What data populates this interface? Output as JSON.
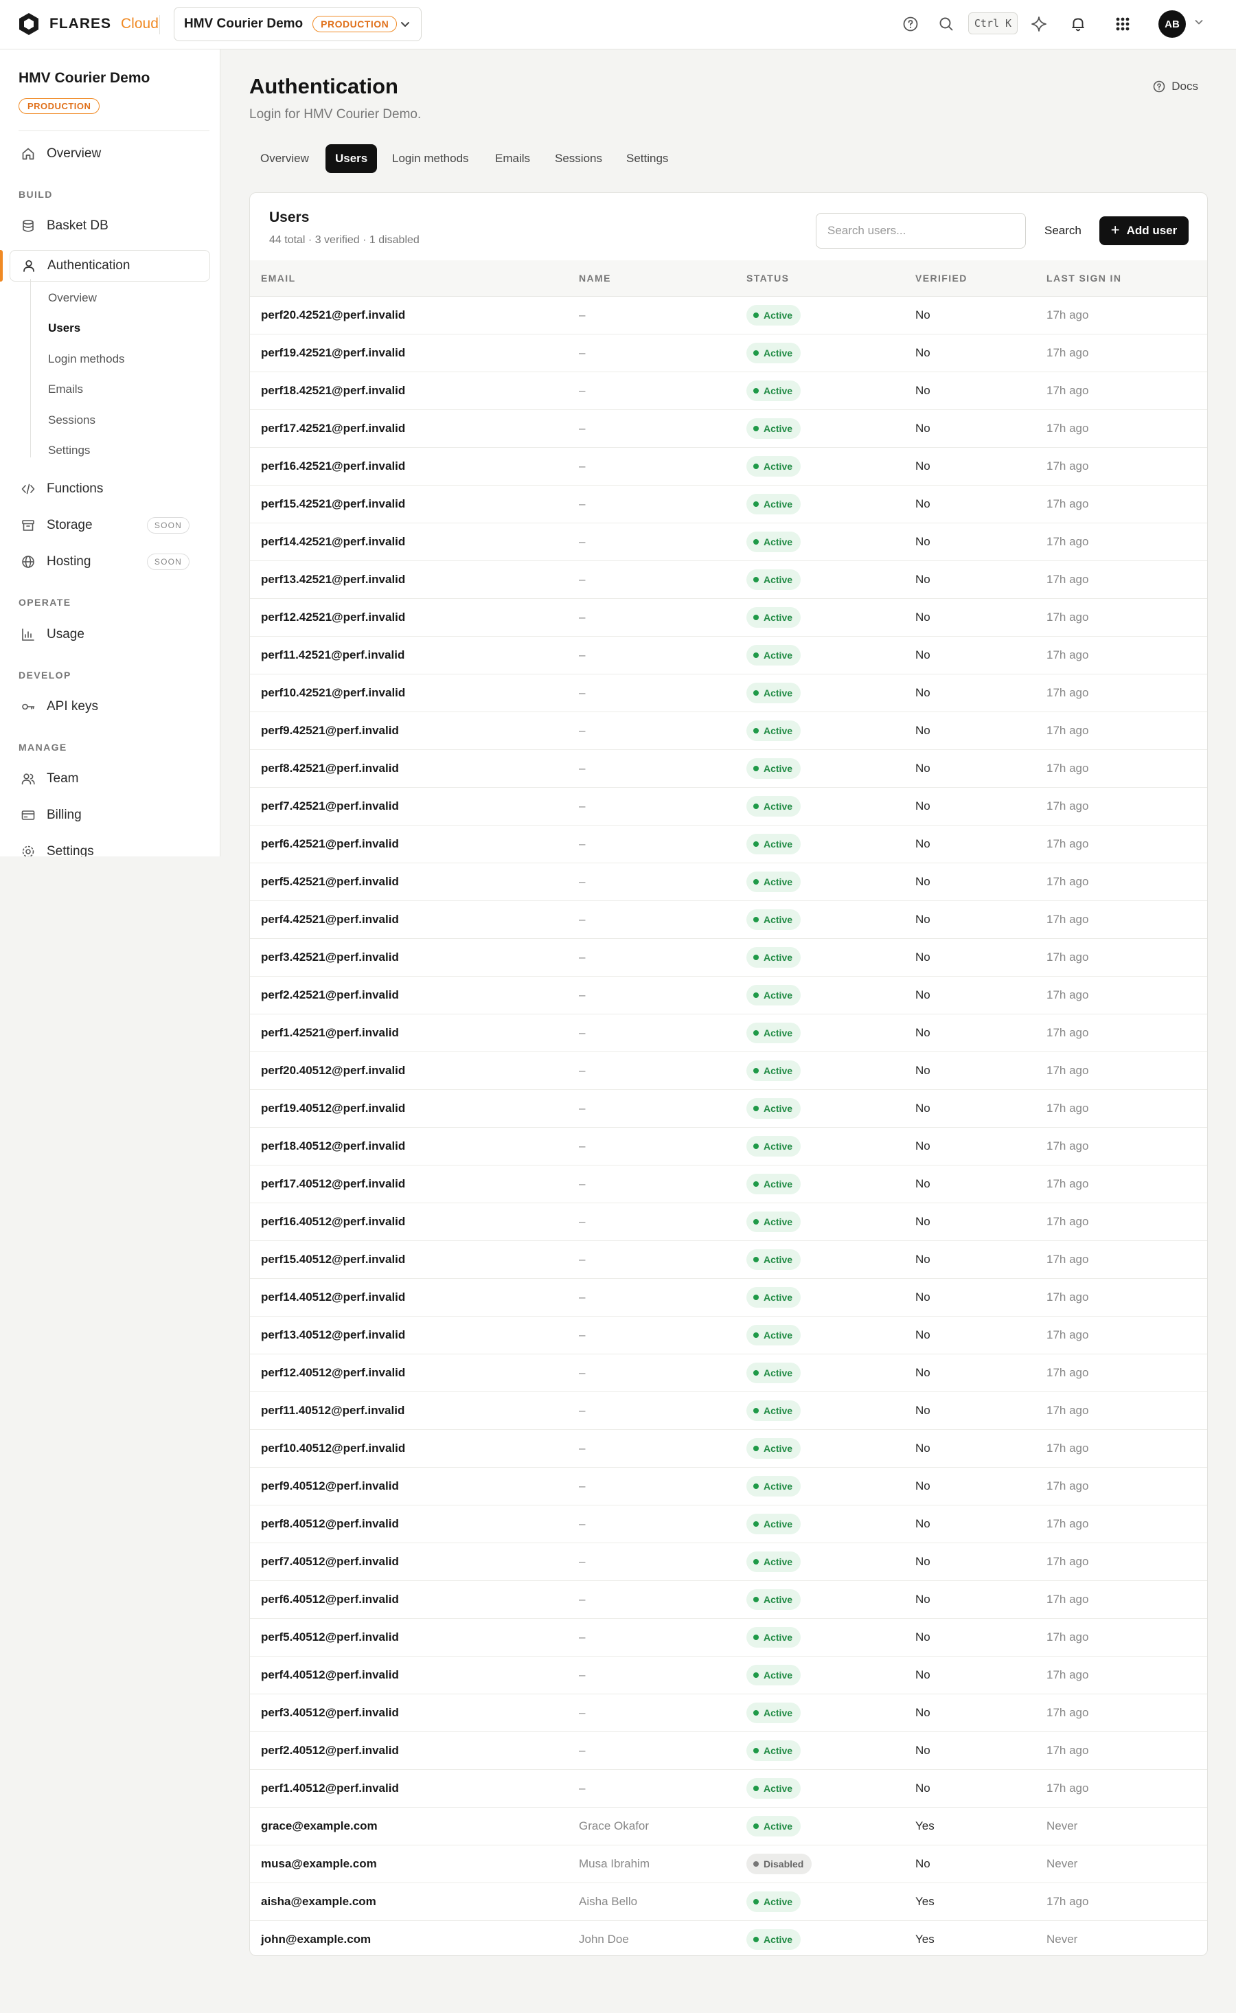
{
  "topbar": {
    "brand": "FLARES",
    "brand_sub": "Cloud",
    "project_name": "HMV Courier Demo",
    "env": "PRODUCTION",
    "shortcut": "Ctrl K",
    "avatar_initials": "AB"
  },
  "sidebar": {
    "project_name": "HMV Courier Demo",
    "env": "PRODUCTION",
    "overview": "Overview",
    "sections": {
      "build": "BUILD",
      "operate": "OPERATE",
      "develop": "DEVELOP",
      "manage": "MANAGE"
    },
    "basket_db": "Basket DB",
    "authentication": "Authentication",
    "auth_sub": [
      "Overview",
      "Users",
      "Login methods",
      "Emails",
      "Sessions",
      "Settings"
    ],
    "functions": "Functions",
    "storage": "Storage",
    "hosting": "Hosting",
    "soon": "SOON",
    "usage": "Usage",
    "api_keys": "API keys",
    "team": "Team",
    "billing": "Billing",
    "settings": "Settings"
  },
  "main": {
    "title": "Authentication",
    "subtitle": "Login for HMV Courier Demo.",
    "docs": "Docs",
    "tabs": [
      "Overview",
      "Users",
      "Login methods",
      "Emails",
      "Sessions",
      "Settings"
    ],
    "active_tab": "Users"
  },
  "users_card": {
    "title": "Users",
    "meta": "44 total · 3 verified · 1 disabled",
    "search_placeholder": "Search users...",
    "search_button": "Search",
    "add_button": "Add user",
    "columns": [
      "EMAIL",
      "NAME",
      "STATUS",
      "VERIFIED",
      "LAST SIGN IN"
    ],
    "rows": [
      {
        "email": "perf20.42521@perf.invalid",
        "name": "–",
        "status": "Active",
        "verified": "No",
        "last": "17h ago"
      },
      {
        "email": "perf19.42521@perf.invalid",
        "name": "–",
        "status": "Active",
        "verified": "No",
        "last": "17h ago"
      },
      {
        "email": "perf18.42521@perf.invalid",
        "name": "–",
        "status": "Active",
        "verified": "No",
        "last": "17h ago"
      },
      {
        "email": "perf17.42521@perf.invalid",
        "name": "–",
        "status": "Active",
        "verified": "No",
        "last": "17h ago"
      },
      {
        "email": "perf16.42521@perf.invalid",
        "name": "–",
        "status": "Active",
        "verified": "No",
        "last": "17h ago"
      },
      {
        "email": "perf15.42521@perf.invalid",
        "name": "–",
        "status": "Active",
        "verified": "No",
        "last": "17h ago"
      },
      {
        "email": "perf14.42521@perf.invalid",
        "name": "–",
        "status": "Active",
        "verified": "No",
        "last": "17h ago"
      },
      {
        "email": "perf13.42521@perf.invalid",
        "name": "–",
        "status": "Active",
        "verified": "No",
        "last": "17h ago"
      },
      {
        "email": "perf12.42521@perf.invalid",
        "name": "–",
        "status": "Active",
        "verified": "No",
        "last": "17h ago"
      },
      {
        "email": "perf11.42521@perf.invalid",
        "name": "–",
        "status": "Active",
        "verified": "No",
        "last": "17h ago"
      },
      {
        "email": "perf10.42521@perf.invalid",
        "name": "–",
        "status": "Active",
        "verified": "No",
        "last": "17h ago"
      },
      {
        "email": "perf9.42521@perf.invalid",
        "name": "–",
        "status": "Active",
        "verified": "No",
        "last": "17h ago"
      },
      {
        "email": "perf8.42521@perf.invalid",
        "name": "–",
        "status": "Active",
        "verified": "No",
        "last": "17h ago"
      },
      {
        "email": "perf7.42521@perf.invalid",
        "name": "–",
        "status": "Active",
        "verified": "No",
        "last": "17h ago"
      },
      {
        "email": "perf6.42521@perf.invalid",
        "name": "–",
        "status": "Active",
        "verified": "No",
        "last": "17h ago"
      },
      {
        "email": "perf5.42521@perf.invalid",
        "name": "–",
        "status": "Active",
        "verified": "No",
        "last": "17h ago"
      },
      {
        "email": "perf4.42521@perf.invalid",
        "name": "–",
        "status": "Active",
        "verified": "No",
        "last": "17h ago"
      },
      {
        "email": "perf3.42521@perf.invalid",
        "name": "–",
        "status": "Active",
        "verified": "No",
        "last": "17h ago"
      },
      {
        "email": "perf2.42521@perf.invalid",
        "name": "–",
        "status": "Active",
        "verified": "No",
        "last": "17h ago"
      },
      {
        "email": "perf1.42521@perf.invalid",
        "name": "–",
        "status": "Active",
        "verified": "No",
        "last": "17h ago"
      },
      {
        "email": "perf20.40512@perf.invalid",
        "name": "–",
        "status": "Active",
        "verified": "No",
        "last": "17h ago"
      },
      {
        "email": "perf19.40512@perf.invalid",
        "name": "–",
        "status": "Active",
        "verified": "No",
        "last": "17h ago"
      },
      {
        "email": "perf18.40512@perf.invalid",
        "name": "–",
        "status": "Active",
        "verified": "No",
        "last": "17h ago"
      },
      {
        "email": "perf17.40512@perf.invalid",
        "name": "–",
        "status": "Active",
        "verified": "No",
        "last": "17h ago"
      },
      {
        "email": "perf16.40512@perf.invalid",
        "name": "–",
        "status": "Active",
        "verified": "No",
        "last": "17h ago"
      },
      {
        "email": "perf15.40512@perf.invalid",
        "name": "–",
        "status": "Active",
        "verified": "No",
        "last": "17h ago"
      },
      {
        "email": "perf14.40512@perf.invalid",
        "name": "–",
        "status": "Active",
        "verified": "No",
        "last": "17h ago"
      },
      {
        "email": "perf13.40512@perf.invalid",
        "name": "–",
        "status": "Active",
        "verified": "No",
        "last": "17h ago"
      },
      {
        "email": "perf12.40512@perf.invalid",
        "name": "–",
        "status": "Active",
        "verified": "No",
        "last": "17h ago"
      },
      {
        "email": "perf11.40512@perf.invalid",
        "name": "–",
        "status": "Active",
        "verified": "No",
        "last": "17h ago"
      },
      {
        "email": "perf10.40512@perf.invalid",
        "name": "–",
        "status": "Active",
        "verified": "No",
        "last": "17h ago"
      },
      {
        "email": "perf9.40512@perf.invalid",
        "name": "–",
        "status": "Active",
        "verified": "No",
        "last": "17h ago"
      },
      {
        "email": "perf8.40512@perf.invalid",
        "name": "–",
        "status": "Active",
        "verified": "No",
        "last": "17h ago"
      },
      {
        "email": "perf7.40512@perf.invalid",
        "name": "–",
        "status": "Active",
        "verified": "No",
        "last": "17h ago"
      },
      {
        "email": "perf6.40512@perf.invalid",
        "name": "–",
        "status": "Active",
        "verified": "No",
        "last": "17h ago"
      },
      {
        "email": "perf5.40512@perf.invalid",
        "name": "–",
        "status": "Active",
        "verified": "No",
        "last": "17h ago"
      },
      {
        "email": "perf4.40512@perf.invalid",
        "name": "–",
        "status": "Active",
        "verified": "No",
        "last": "17h ago"
      },
      {
        "email": "perf3.40512@perf.invalid",
        "name": "–",
        "status": "Active",
        "verified": "No",
        "last": "17h ago"
      },
      {
        "email": "perf2.40512@perf.invalid",
        "name": "–",
        "status": "Active",
        "verified": "No",
        "last": "17h ago"
      },
      {
        "email": "perf1.40512@perf.invalid",
        "name": "–",
        "status": "Active",
        "verified": "No",
        "last": "17h ago"
      },
      {
        "email": "grace@example.com",
        "name": "Grace Okafor",
        "status": "Active",
        "verified": "Yes",
        "last": "Never"
      },
      {
        "email": "musa@example.com",
        "name": "Musa Ibrahim",
        "status": "Disabled",
        "verified": "No",
        "last": "Never"
      },
      {
        "email": "aisha@example.com",
        "name": "Aisha Bello",
        "status": "Active",
        "verified": "Yes",
        "last": "17h ago"
      },
      {
        "email": "john@example.com",
        "name": "John Doe",
        "status": "Active",
        "verified": "Yes",
        "last": "Never"
      }
    ]
  },
  "colors": {
    "accent": "#f08a24",
    "active_badge_bg": "#e8f6ec",
    "active_badge_text": "#1f8a43",
    "disabled_badge_bg": "#ececea",
    "primary_button": "#111111"
  }
}
